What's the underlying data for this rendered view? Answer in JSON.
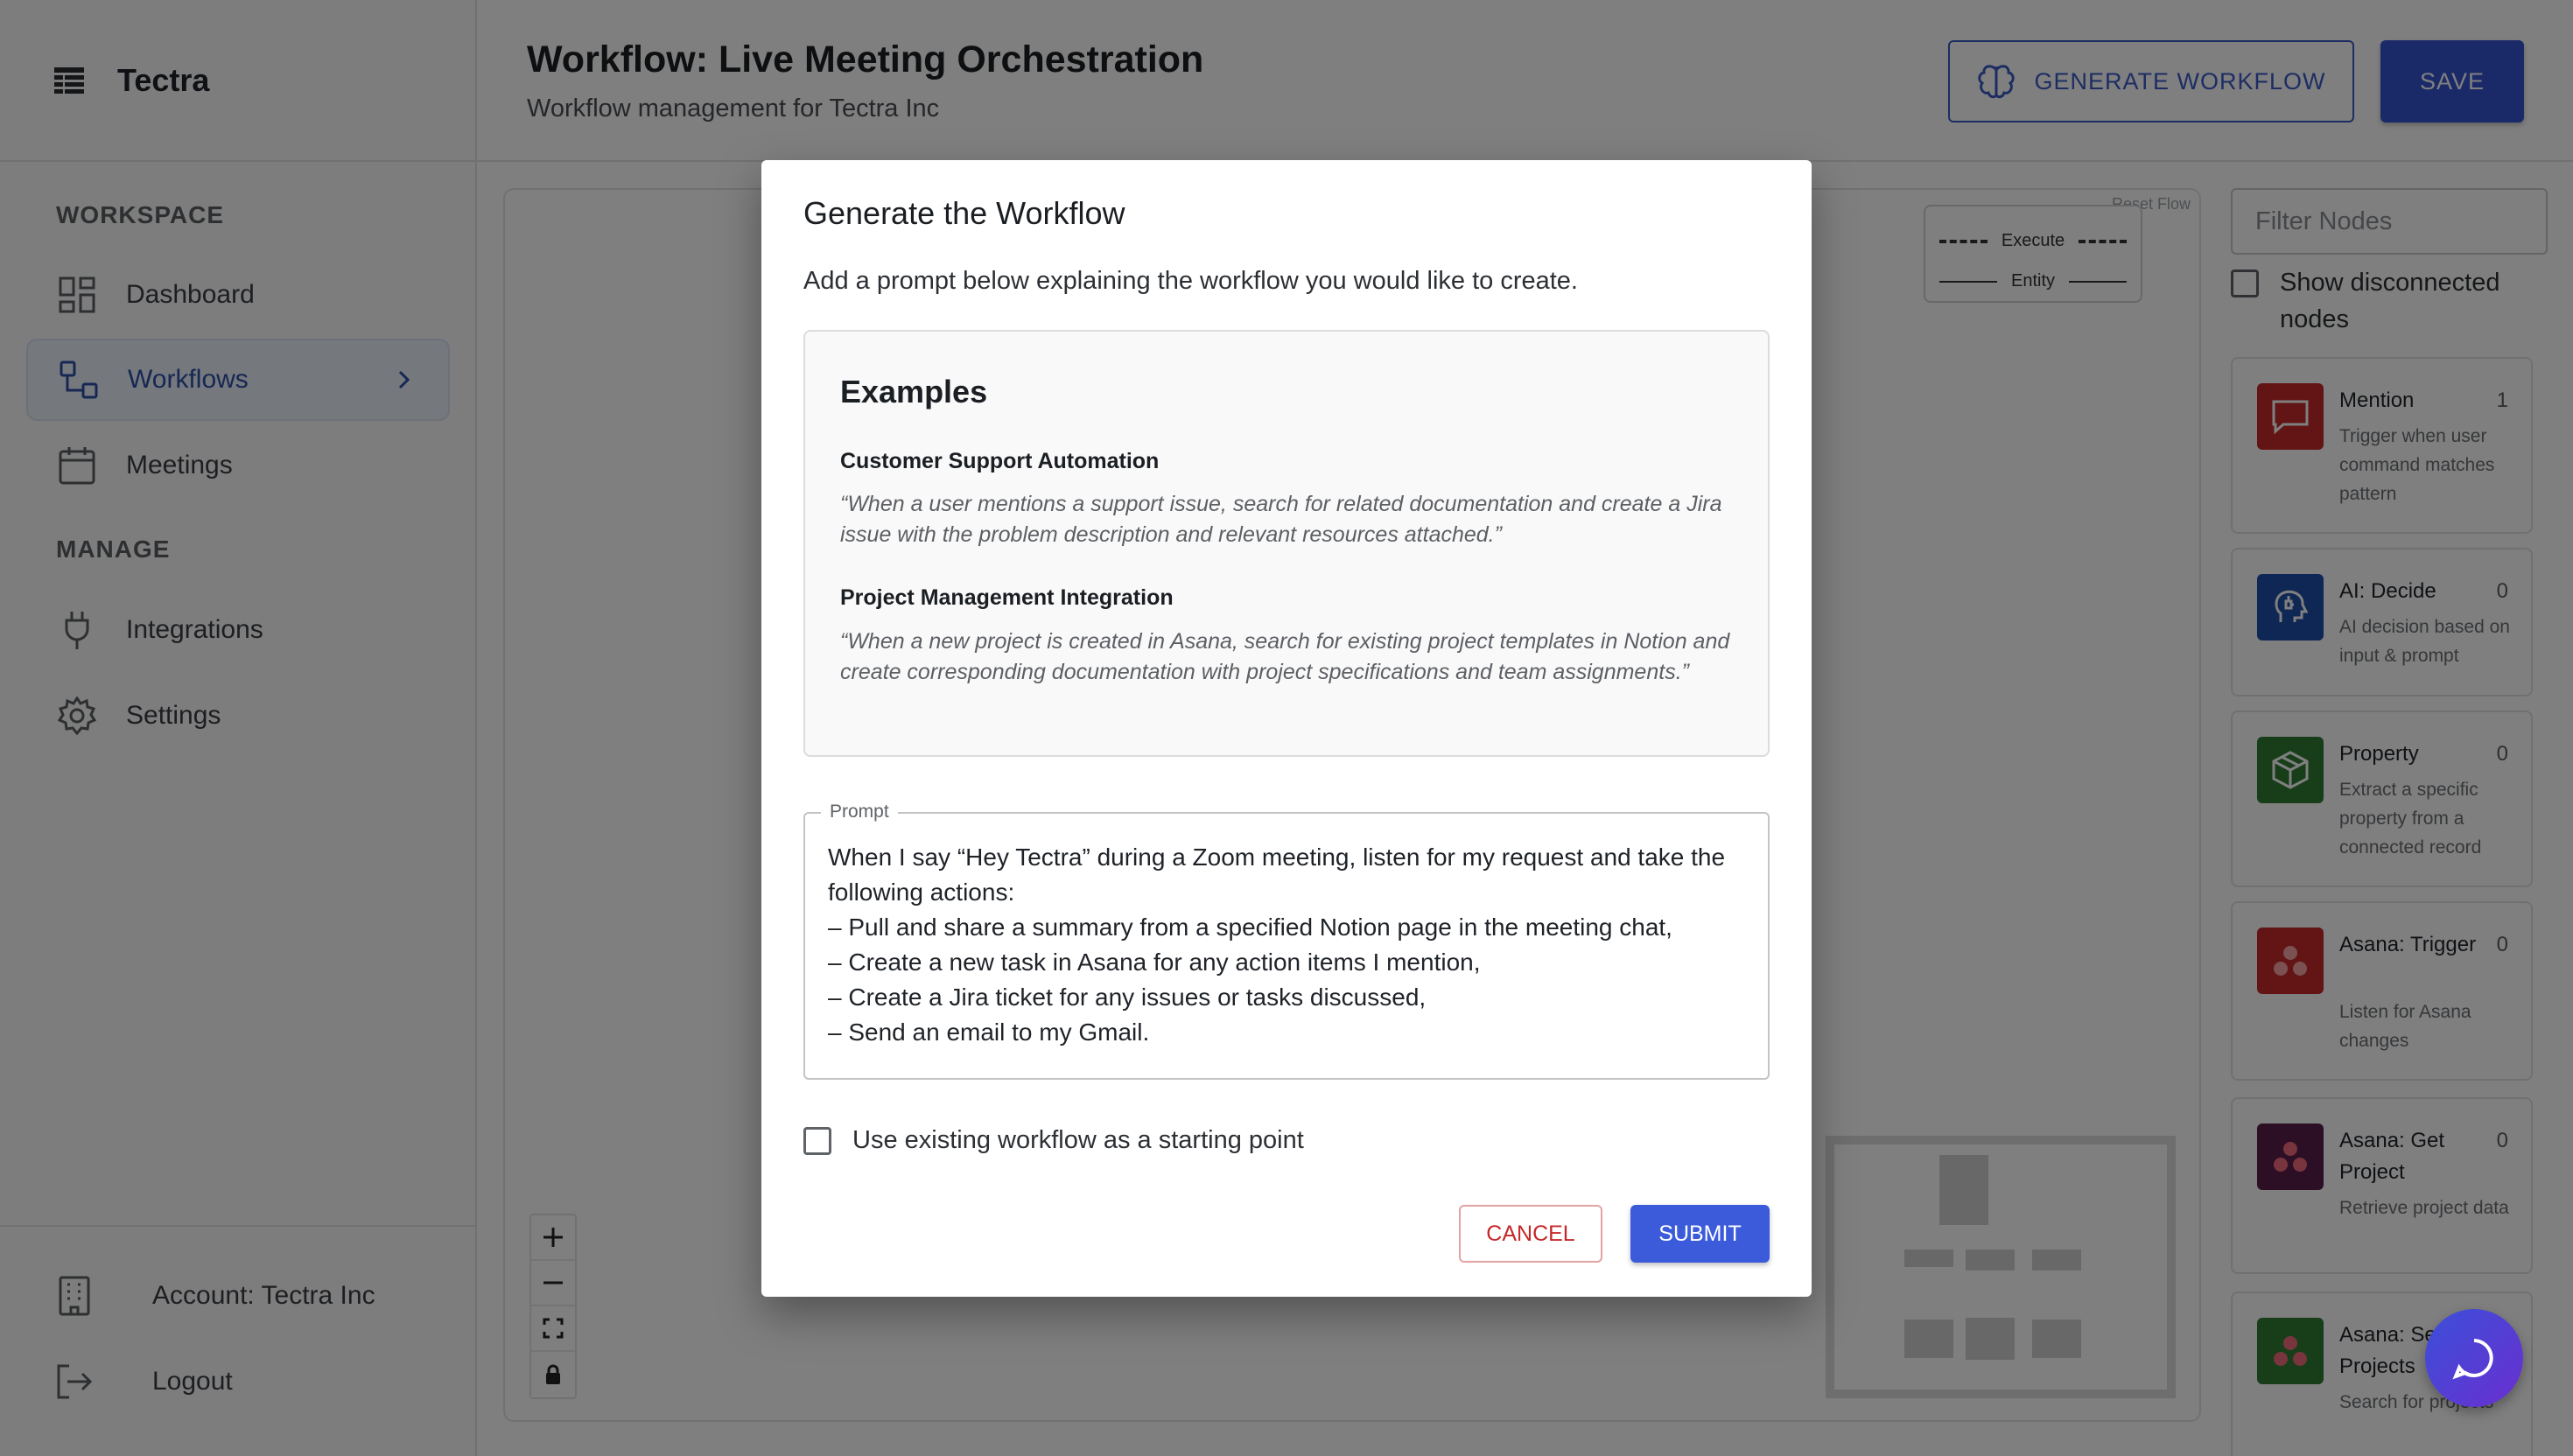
{
  "app": {
    "name": "Tectra"
  },
  "sidebar": {
    "workspace_title": "WORKSPACE",
    "manage_title": "MANAGE",
    "items": [
      {
        "label": "Dashboard",
        "icon": "dashboard-icon"
      },
      {
        "label": "Workflows",
        "icon": "workflow-icon",
        "active": true
      },
      {
        "label": "Meetings",
        "icon": "calendar-icon"
      },
      {
        "label": "Integrations",
        "icon": "plug-icon"
      },
      {
        "label": "Settings",
        "icon": "gear-icon"
      }
    ],
    "account_label": "Account: Tectra Inc",
    "logout_label": "Logout"
  },
  "header": {
    "title": "Workflow: Live Meeting Orchestration",
    "subtitle": "Workflow management for Tectra Inc",
    "generate_label": "GENERATE WORKFLOW",
    "save_label": "SAVE"
  },
  "canvas": {
    "reset_label": "Reset Flow",
    "legend_execute": "Execute",
    "legend_entity": "Entity"
  },
  "node_panel": {
    "filter_placeholder": "Filter Nodes",
    "show_disconnected_label": "Show disconnected nodes",
    "nodes": [
      {
        "title": "Mention",
        "count": "1",
        "description": "Trigger when user command matches pattern",
        "color": "#c62828"
      },
      {
        "title": "AI: Decide",
        "count": "0",
        "description": "AI decision based on input & prompt",
        "color": "#1e4fa8"
      },
      {
        "title": "Property",
        "count": "0",
        "description": "Extract a specific property from a connected record",
        "color": "#2e7d32"
      },
      {
        "title": "Asana: Trigger",
        "count": "0",
        "description": "Listen for Asana changes",
        "color": "#c62828"
      },
      {
        "title": "Asana: Get Project",
        "count": "0",
        "description": "Retrieve project data",
        "color": "#5a1f4a"
      },
      {
        "title": "Asana: Search Projects",
        "count": "",
        "description": "Search for projects",
        "color": "#2e7d32"
      }
    ]
  },
  "modal": {
    "title": "Generate the Workflow",
    "description": "Add a prompt below explaining the workflow you would like to create.",
    "examples_title": "Examples",
    "examples": [
      {
        "name": "Customer Support Automation",
        "quote": "“When a user mentions a support issue, search for related documentation and create a Jira issue with the problem description and relevant resources attached.”"
      },
      {
        "name": "Project Management Integration",
        "quote": "“When a new project is created in Asana, search for existing project templates in Notion and create corresponding documentation with project specifications and team assignments.”"
      }
    ],
    "prompt_label": "Prompt",
    "prompt_text": "When I say “Hey Tectra” during a Zoom meeting, listen for my request and take the following actions:\n– Pull and share a summary from a specified Notion page in the meeting chat,\n– Create a new task in Asana for any action items I mention,\n– Create a Jira ticket for any issues or tasks discussed,\n– Send an email to my Gmail.",
    "existing_label": "Use existing workflow as a starting point",
    "cancel_label": "CANCEL",
    "submit_label": "SUBMIT"
  },
  "colors": {
    "accent": "#3b5bdb",
    "cancel": "#c62828"
  }
}
